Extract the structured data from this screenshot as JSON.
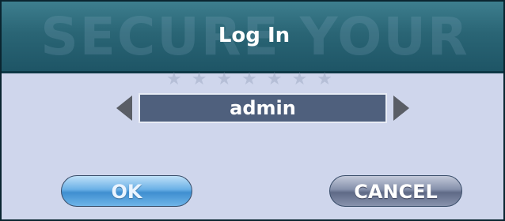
{
  "dialog": {
    "watermark": "SECURE YOUR",
    "title": "Log In",
    "decoration_stars": "★★★★★★★",
    "user_selector": {
      "value": "admin",
      "prev_icon": "triangle-left-icon",
      "next_icon": "triangle-right-icon"
    },
    "buttons": {
      "ok_label": "OK",
      "cancel_label": "CANCEL"
    }
  },
  "colors": {
    "titlebar": "#2a6575",
    "body": "#cfd6ec",
    "value_box": "#4f607d",
    "ok_button": "#6ab0e6",
    "cancel_button": "#8590ab"
  }
}
